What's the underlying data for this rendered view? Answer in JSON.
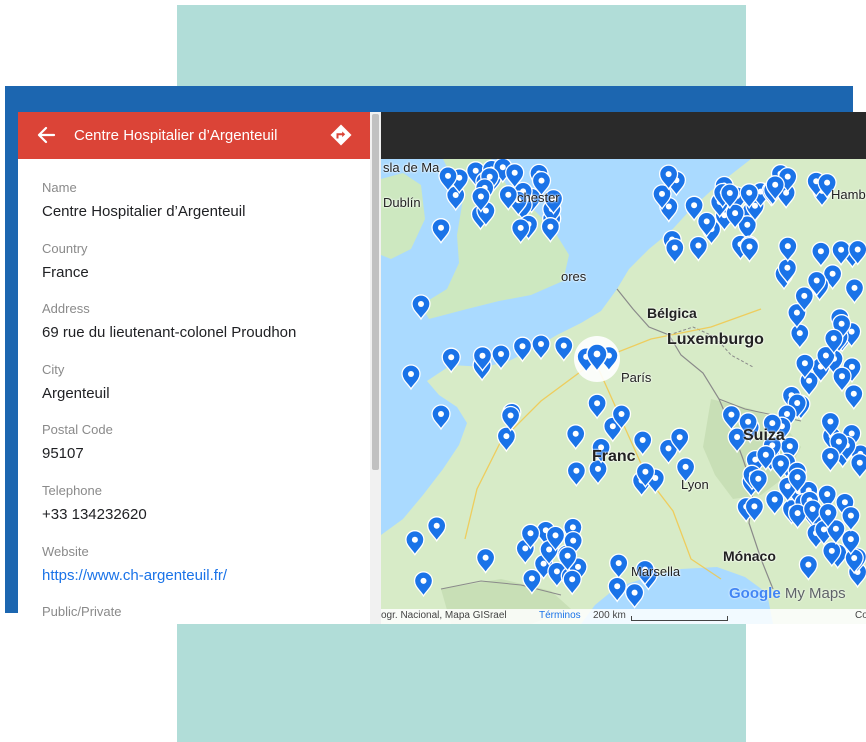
{
  "colors": {
    "header": "#db4437",
    "frame": "#1c66b0",
    "teal": "#b1ddd8",
    "marker": "#1a73e8",
    "link": "#1a73e8"
  },
  "panel": {
    "title": "Centre Hospitalier d’Argenteuil",
    "back_icon": "arrow-left-icon",
    "directions_icon": "directions-icon",
    "fields": [
      {
        "label": "Name",
        "value": "Centre Hospitalier d’Argenteuil"
      },
      {
        "label": "Country",
        "value": "France"
      },
      {
        "label": "Address",
        "value": "69 rue du lieutenant-colonel Proudhon"
      },
      {
        "label": "City",
        "value": "Argenteuil"
      },
      {
        "label": "Postal Code",
        "value": "95107"
      },
      {
        "label": "Telephone",
        "value": "+33 134232620"
      },
      {
        "label": "Website",
        "value": "https://www.ch-argenteuil.fr/"
      },
      {
        "label": "Public/Private",
        "value": ""
      }
    ]
  },
  "map": {
    "labels": [
      "sla de Ma",
      "Dublín",
      "chester",
      "ores",
      "Hambu",
      "Bélgica",
      "Luxemburgo",
      "París",
      "Suiza",
      "Franc",
      "Lyon",
      "Mónaco",
      "Marsella"
    ],
    "attribution": {
      "text": "ogr. Nacional, Mapa GISrael",
      "terms": "Términos",
      "scale": "200 km",
      "co": "Co"
    },
    "logo": {
      "google": "Google",
      "my_maps": "My Maps"
    }
  }
}
